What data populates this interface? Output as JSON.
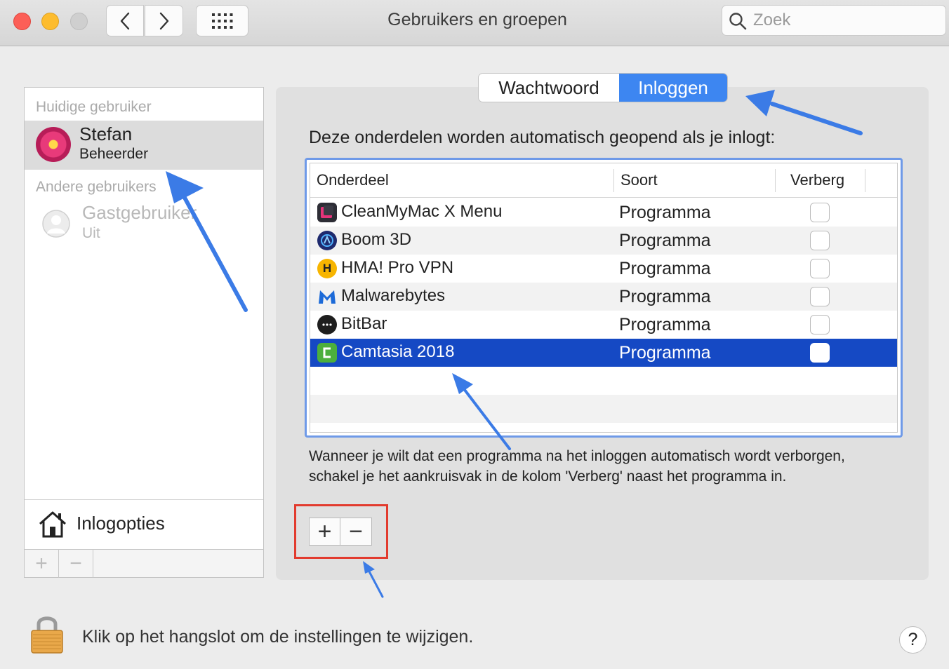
{
  "window": {
    "title": "Gebruikers en groepen",
    "search_placeholder": "Zoek"
  },
  "sidebar": {
    "current_header": "Huidige gebruiker",
    "current_user": {
      "name": "Stefan",
      "role": "Beheerder"
    },
    "others_header": "Andere gebruikers",
    "guest": {
      "name": "Gastgebruiker",
      "status": "Uit"
    },
    "login_options_label": "Inlogopties",
    "add_symbol": "+",
    "remove_symbol": "−"
  },
  "tabs": {
    "password": "Wachtwoord",
    "login": "Inloggen",
    "selected": "login"
  },
  "login_items": {
    "heading": "Deze onderdelen worden automatisch geopend als je inlogt:",
    "columns": {
      "name": "Onderdeel",
      "type": "Soort",
      "hide": "Verberg"
    },
    "rows": [
      {
        "name": "CleanMyMac X Menu",
        "type": "Programma",
        "hidden": false,
        "icon": "cleanmymac-icon",
        "selected": false
      },
      {
        "name": "Boom 3D",
        "type": "Programma",
        "hidden": false,
        "icon": "boom3d-icon",
        "selected": false
      },
      {
        "name": "HMA! Pro VPN",
        "type": "Programma",
        "hidden": false,
        "icon": "hma-icon",
        "selected": false
      },
      {
        "name": "Malwarebytes",
        "type": "Programma",
        "hidden": false,
        "icon": "malwarebytes-icon",
        "selected": false
      },
      {
        "name": "BitBar",
        "type": "Programma",
        "hidden": false,
        "icon": "bitbar-icon",
        "selected": false
      },
      {
        "name": "Camtasia 2018",
        "type": "Programma",
        "hidden": false,
        "icon": "camtasia-icon",
        "selected": true
      }
    ],
    "help_text": "Wanneer je wilt dat een programma na het inloggen automatisch wordt verborgen, schakel je het aankruisvak in de kolom 'Verberg' naast het programma in.",
    "add_symbol": "+",
    "remove_symbol": "−"
  },
  "footer": {
    "lock_text": "Klik op het hangslot om de instellingen te wijzigen.",
    "help_symbol": "?"
  },
  "colors": {
    "accent": "#3d86f1",
    "selection": "#1549c4",
    "annotation_arrow": "#3b7be6",
    "annotation_box": "#e23b2e"
  }
}
